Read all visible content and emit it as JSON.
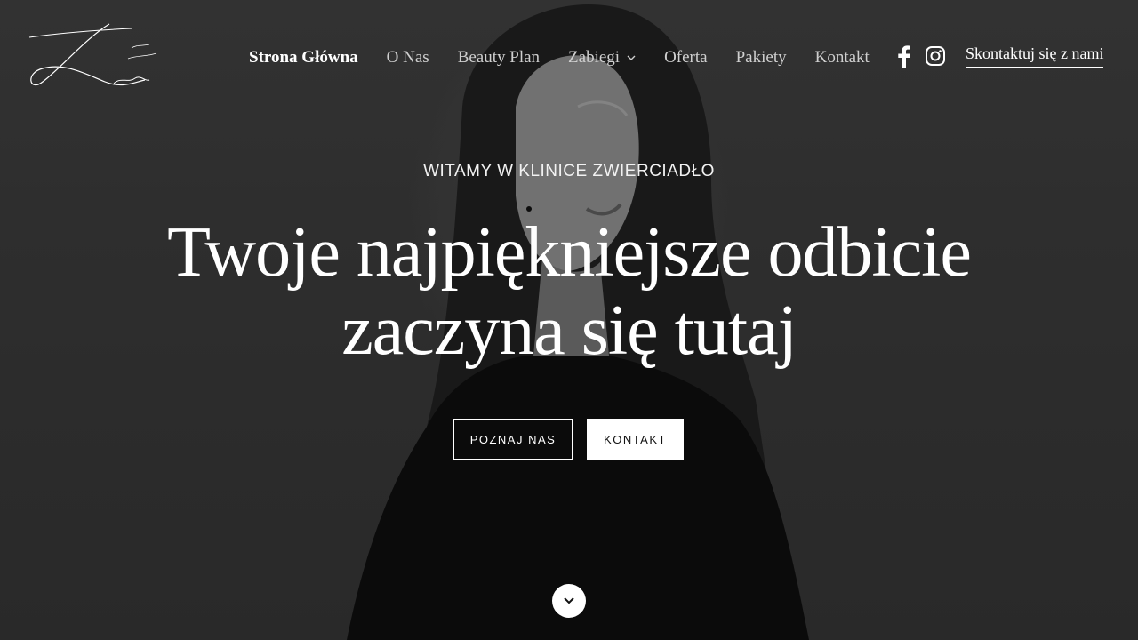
{
  "nav": {
    "items": [
      {
        "label": "Strona Główna",
        "active": true
      },
      {
        "label": "O Nas"
      },
      {
        "label": "Beauty Plan"
      },
      {
        "label": "Zabiegi",
        "has_dropdown": true
      },
      {
        "label": "Oferta"
      },
      {
        "label": "Pakiety"
      },
      {
        "label": "Kontakt"
      }
    ],
    "social_icons": [
      "facebook-icon",
      "instagram-icon"
    ],
    "cta_label": "Skontaktuj się z nami"
  },
  "hero": {
    "kicker": "WITAMY W KLINICE ZWIERCIADŁO",
    "headline_line1": "Twoje najpiękniejsze odbicie",
    "headline_line2": "zaczyna się tutaj",
    "primary_button": "POZNAJ NAS",
    "secondary_button": "KONTAKT",
    "scroll_icon": "chevron-down-icon"
  },
  "colors": {
    "background": "#3a3a3a",
    "text": "#ffffff",
    "nav_inactive": "#cfcfcf",
    "button_dark_text": "#111111"
  }
}
